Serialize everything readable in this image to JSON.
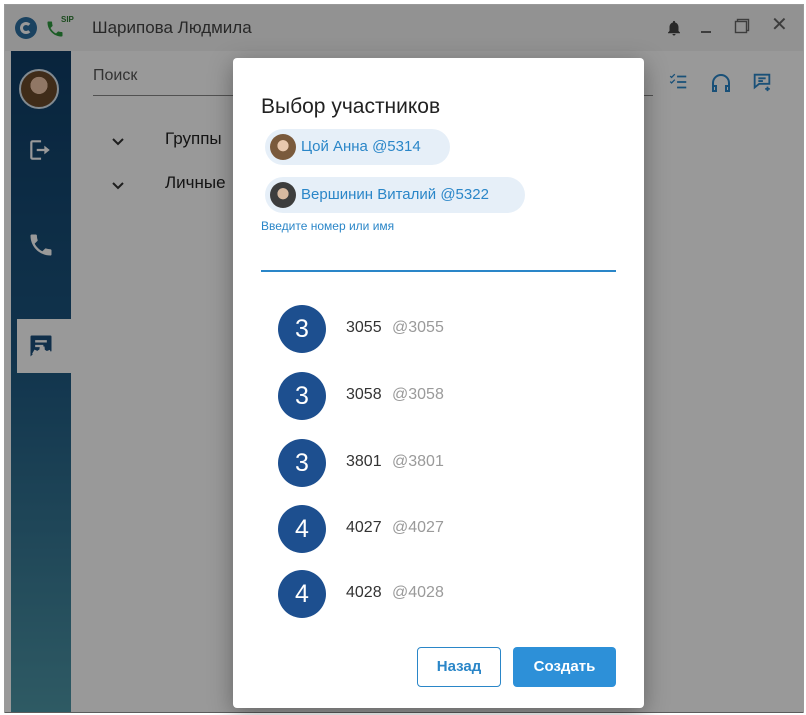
{
  "window": {
    "title": "Шарипова Людмила",
    "sip_label": "SIP",
    "close_glyph": "✕"
  },
  "sidebar": {
    "items": [
      {
        "icon": "avatar"
      },
      {
        "icon": "logout-icon"
      },
      {
        "icon": "phone-icon"
      },
      {
        "icon": "chat-icon",
        "active": true
      },
      {
        "icon": "gear-icon"
      }
    ]
  },
  "main": {
    "search_placeholder": "Поиск",
    "groups": [
      {
        "label": "Группы"
      },
      {
        "label": "Личные"
      }
    ],
    "toolbar_icons": [
      "checklist-icon",
      "headset-icon",
      "new-chat-icon"
    ]
  },
  "dialog": {
    "title": "Выбор участников",
    "selected": [
      {
        "name": "Цой Анна @5314"
      },
      {
        "name": "Вершинин Виталий @5322"
      }
    ],
    "input_placeholder": "Введите номер или имя",
    "contacts": [
      {
        "initial": "3",
        "name": "3055",
        "handle": "@3055"
      },
      {
        "initial": "3",
        "name": "3058",
        "handle": "@3058"
      },
      {
        "initial": "3",
        "name": "3801",
        "handle": "@3801"
      },
      {
        "initial": "4",
        "name": "4027",
        "handle": "@4027"
      },
      {
        "initial": "4",
        "name": "4028",
        "handle": "@4028"
      }
    ],
    "back_label": "Назад",
    "create_label": "Создать"
  },
  "colors": {
    "accent": "#2a86c8",
    "contact_avatar": "#1d4f8f",
    "chip_bg": "#e6eff8",
    "sidebar_top": "#0f3d66"
  }
}
